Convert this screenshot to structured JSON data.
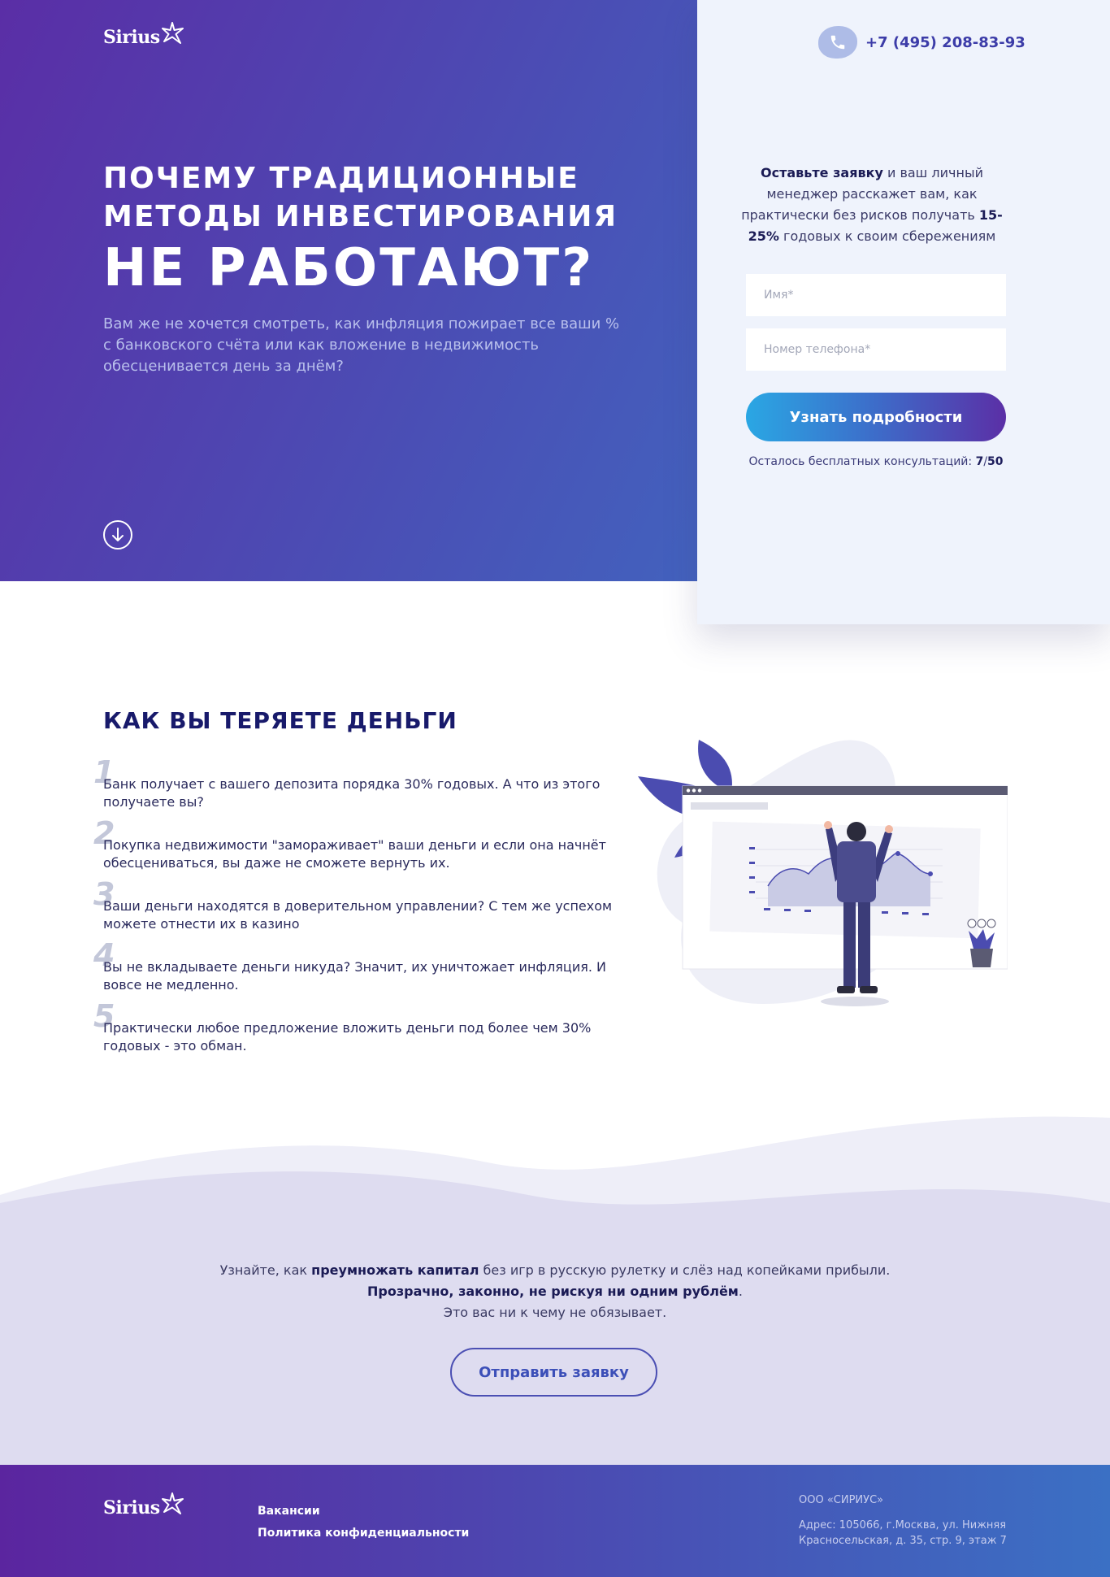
{
  "brand": {
    "logo_text": "Sirius"
  },
  "hero": {
    "title_line1": "ПОЧЕМУ ТРАДИЦИОННЫЕ",
    "title_line2": "МЕТОДЫ ИНВЕСТИРОВАНИЯ",
    "title_line3": "НЕ РАБОТАЮТ?",
    "subtitle": "Вам же не хочется смотреть, как инфляция пожирает все ваши % с банковского счёта или как вложение в недвижимость обесценивается день за днём?"
  },
  "contact": {
    "phone": "+7 (495) 208-83-93"
  },
  "form": {
    "lead_bold": "Оставьте заявку",
    "lead_text": " и ваш личный менеджер расскажет вам, как практически без рисков получать ",
    "lead_rate": "15-25%",
    "lead_tail": " годовых к своим сбережениям",
    "name_placeholder": "Имя*",
    "phone_placeholder": "Номер телефона*",
    "submit_label": "Узнать подробности",
    "remaining_label": "Осталось бесплатных консультаций: ",
    "remaining_count": "7",
    "remaining_sep": "/",
    "remaining_total": "50"
  },
  "losses": {
    "title": "КАК ВЫ ТЕРЯЕТЕ ДЕНЬГИ",
    "items": [
      {
        "num": "1",
        "text": "Банк получает с вашего депозита порядка 30% годовых. А что из этого получаете вы?"
      },
      {
        "num": "2",
        "text": "Покупка недвижимости \"замораживает\" ваши деньги и если она начнёт обесцениваться, вы даже не сможете вернуть их."
      },
      {
        "num": "3",
        "text": "Ваши деньги находятся в доверительном управлении? С тем же успехом можете отнести их в казино"
      },
      {
        "num": "4",
        "text": "Вы не вкладываете деньги никуда? Значит, их уничтожает инфляция. И вовсе не медленно."
      },
      {
        "num": "5",
        "text": "Практически любое предложение вложить деньги под более чем 30% годовых - это обман."
      }
    ]
  },
  "cta": {
    "line1_a": "Узнайте, как ",
    "line1_b": "преумножать капитал",
    "line1_c": " без игр в русскую рулетку и слёз над копейками прибыли.",
    "line2": "Прозрачно, законно, не рискуя ни одним рублём",
    "line2_end": ".",
    "line3": "Это вас ни к чему не обязывает.",
    "button_label": "Отправить заявку"
  },
  "footer": {
    "links": [
      "Вакансии",
      "Политика конфиденциальности"
    ],
    "company": "ООО «СИРИУС»",
    "address_line1": "Адрес: 105066, г.Москва, ул. Нижняя",
    "address_line2": "Красносельская, д. 35, стр. 9, этаж 7"
  },
  "colors": {
    "hero_gradient_start": "#5a2ea6",
    "hero_gradient_end": "#3a78c8",
    "panel_bg": "#eff3fc",
    "heading_navy": "#181a6b",
    "cta_bg": "#dedcf0"
  }
}
